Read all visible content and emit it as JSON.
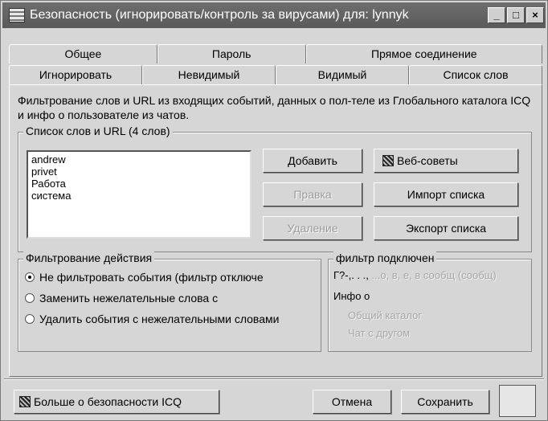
{
  "window": {
    "title": "Безопасность (игнорировать/контроль за вирусами) для: lynnyk",
    "minimize": "_",
    "maximize": "□",
    "close": "×"
  },
  "tabs": {
    "row1": [
      "Общее",
      "Пароль",
      "Прямое соединение"
    ],
    "row2": [
      "Игнорировать",
      "Невидимый",
      "Видимый",
      "Список слов"
    ],
    "active": "Список слов"
  },
  "panel": {
    "description": "Фильтрование слов и URL из входящих событий, данных о пол-теле из Глобального каталога ICQ и инфо о пользователе из чатов.",
    "wordlist": {
      "legend": "Список слов и URL (4 слов)",
      "items": [
        "andrew",
        "privet",
        "Работа",
        "система"
      ]
    },
    "buttons": {
      "add": "Добавить",
      "edit": "Правка",
      "delete": "Удаление",
      "web_tips": "Веб-советы",
      "import": "Импорт списка",
      "export": "Экспорт списка"
    },
    "action": {
      "legend": "Фильтрование действия",
      "options": [
        "Не фильтровать события (фильтр отключе",
        "Заменить нежелательные слова с",
        "Удалить события с нежелательными словами"
      ],
      "selected": 0
    },
    "filter": {
      "legend": "фильтр подключен",
      "line1": "Г?-,. . .,",
      "line1_faint": "...о, в, е, в сообщ (сообщ)",
      "line2": "Инфо о",
      "line3_faint": "Общий каталог",
      "line4_faint": "Чат с другом"
    }
  },
  "footer": {
    "more": "Больше о безопасности ICQ",
    "cancel": "Отмена",
    "save": "Сохранить"
  }
}
